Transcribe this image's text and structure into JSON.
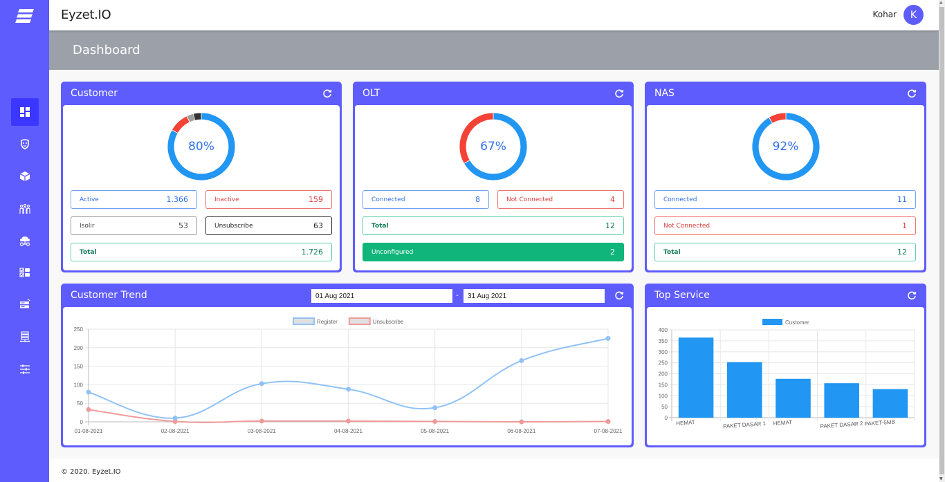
{
  "app": {
    "brand": "Eyzet.IO",
    "page_title": "Dashboard"
  },
  "user": {
    "name": "Kohar",
    "initial": "K"
  },
  "sidebar": {
    "items": [
      {
        "name": "dashboard",
        "icon": "dashboard-icon",
        "active": true
      },
      {
        "name": "customer-mask",
        "icon": "mask-icon",
        "active": false
      },
      {
        "name": "package",
        "icon": "box-icon",
        "active": false
      },
      {
        "name": "users",
        "icon": "people-group-icon",
        "active": false
      },
      {
        "name": "cloud-network",
        "icon": "cloud-network-icon",
        "active": false
      },
      {
        "name": "checklist",
        "icon": "checklist-icon",
        "active": false
      },
      {
        "name": "router",
        "icon": "router-icon",
        "active": false
      },
      {
        "name": "server-network",
        "icon": "server-network-icon",
        "active": false
      },
      {
        "name": "settings",
        "icon": "sliders-icon",
        "active": false
      }
    ]
  },
  "colors": {
    "accent": "#5f5cfe",
    "blue": "#2196f3",
    "red": "#f44336",
    "gray": "#9e9e9e",
    "dark": "#333333",
    "green": "#10b57c"
  },
  "customer": {
    "title": "Customer",
    "percent_label": "80%",
    "donut": [
      {
        "label": "Active",
        "value": 1366,
        "color": "#2196f3"
      },
      {
        "label": "Inactive",
        "value": 159,
        "color": "#f44336"
      },
      {
        "label": "Isolir",
        "value": 53,
        "color": "#9e9e9e"
      },
      {
        "label": "Unsubscribe",
        "value": 63,
        "color": "#333333"
      }
    ],
    "stats": {
      "active": {
        "label": "Active",
        "value": "1.366"
      },
      "inactive": {
        "label": "Inactive",
        "value": "159"
      },
      "isolir": {
        "label": "Isolir",
        "value": "53"
      },
      "unsubscribe": {
        "label": "Unsubscribe",
        "value": "63"
      },
      "total": {
        "label": "Total",
        "value": "1.726"
      }
    }
  },
  "olt": {
    "title": "OLT",
    "percent_label": "67%",
    "donut": [
      {
        "label": "Connected",
        "value": 8,
        "color": "#2196f3"
      },
      {
        "label": "Not Connected",
        "value": 4,
        "color": "#f44336"
      }
    ],
    "stats": {
      "connected": {
        "label": "Connected",
        "value": "8"
      },
      "not_connected": {
        "label": "Not Connected",
        "value": "4"
      },
      "total": {
        "label": "Total",
        "value": "12"
      },
      "unconfigured": {
        "label": "Unconfigured",
        "value": "2"
      }
    }
  },
  "nas": {
    "title": "NAS",
    "percent_label": "92%",
    "donut": [
      {
        "label": "Connected",
        "value": 11,
        "color": "#2196f3"
      },
      {
        "label": "Not Connected",
        "value": 1,
        "color": "#f44336"
      }
    ],
    "stats": {
      "connected": {
        "label": "Connected",
        "value": "11"
      },
      "not_connected": {
        "label": "Not Connected",
        "value": "1"
      },
      "total": {
        "label": "Total",
        "value": "12"
      }
    }
  },
  "trend": {
    "title": "Customer Trend",
    "date_from": "01 Aug 2021",
    "date_sep": "-",
    "date_to": "31 Aug 2021"
  },
  "top_service": {
    "title": "Top Service"
  },
  "chart_data": [
    {
      "type": "line",
      "title": "Customer Trend",
      "x": [
        "01-08-2021",
        "02-08-2021",
        "03-08-2021",
        "04-08-2021",
        "05-08-2021",
        "06-08-2021",
        "07-08-2021"
      ],
      "series": [
        {
          "name": "Register",
          "color": "#90c2f7",
          "values": [
            80,
            10,
            103,
            88,
            38,
            165,
            225
          ]
        },
        {
          "name": "Unsubscribe",
          "color": "#ef9a9a",
          "values": [
            33,
            1,
            2,
            2,
            1,
            0,
            1
          ]
        }
      ],
      "ylim": [
        0,
        250
      ],
      "yticks": [
        0,
        50,
        100,
        150,
        200,
        250
      ],
      "grid": true,
      "legend": "top-center",
      "smooth": true
    },
    {
      "type": "bar",
      "title": "Top Service",
      "categories": [
        "HEMAT",
        "PAKET DASAR 1",
        "HEMAT",
        "PAKET DASAR 2",
        "PAKET-5MB"
      ],
      "series": [
        {
          "name": "Customer",
          "color": "#2196f3",
          "values": [
            365,
            253,
            177,
            157,
            130
          ]
        }
      ],
      "ylim": [
        0,
        400
      ],
      "yticks": [
        0,
        50,
        100,
        150,
        200,
        250,
        300,
        350,
        400
      ],
      "grid": true,
      "legend": "top-center"
    }
  ],
  "footer": {
    "copyright": "© 2020. Eyzet.IO"
  }
}
